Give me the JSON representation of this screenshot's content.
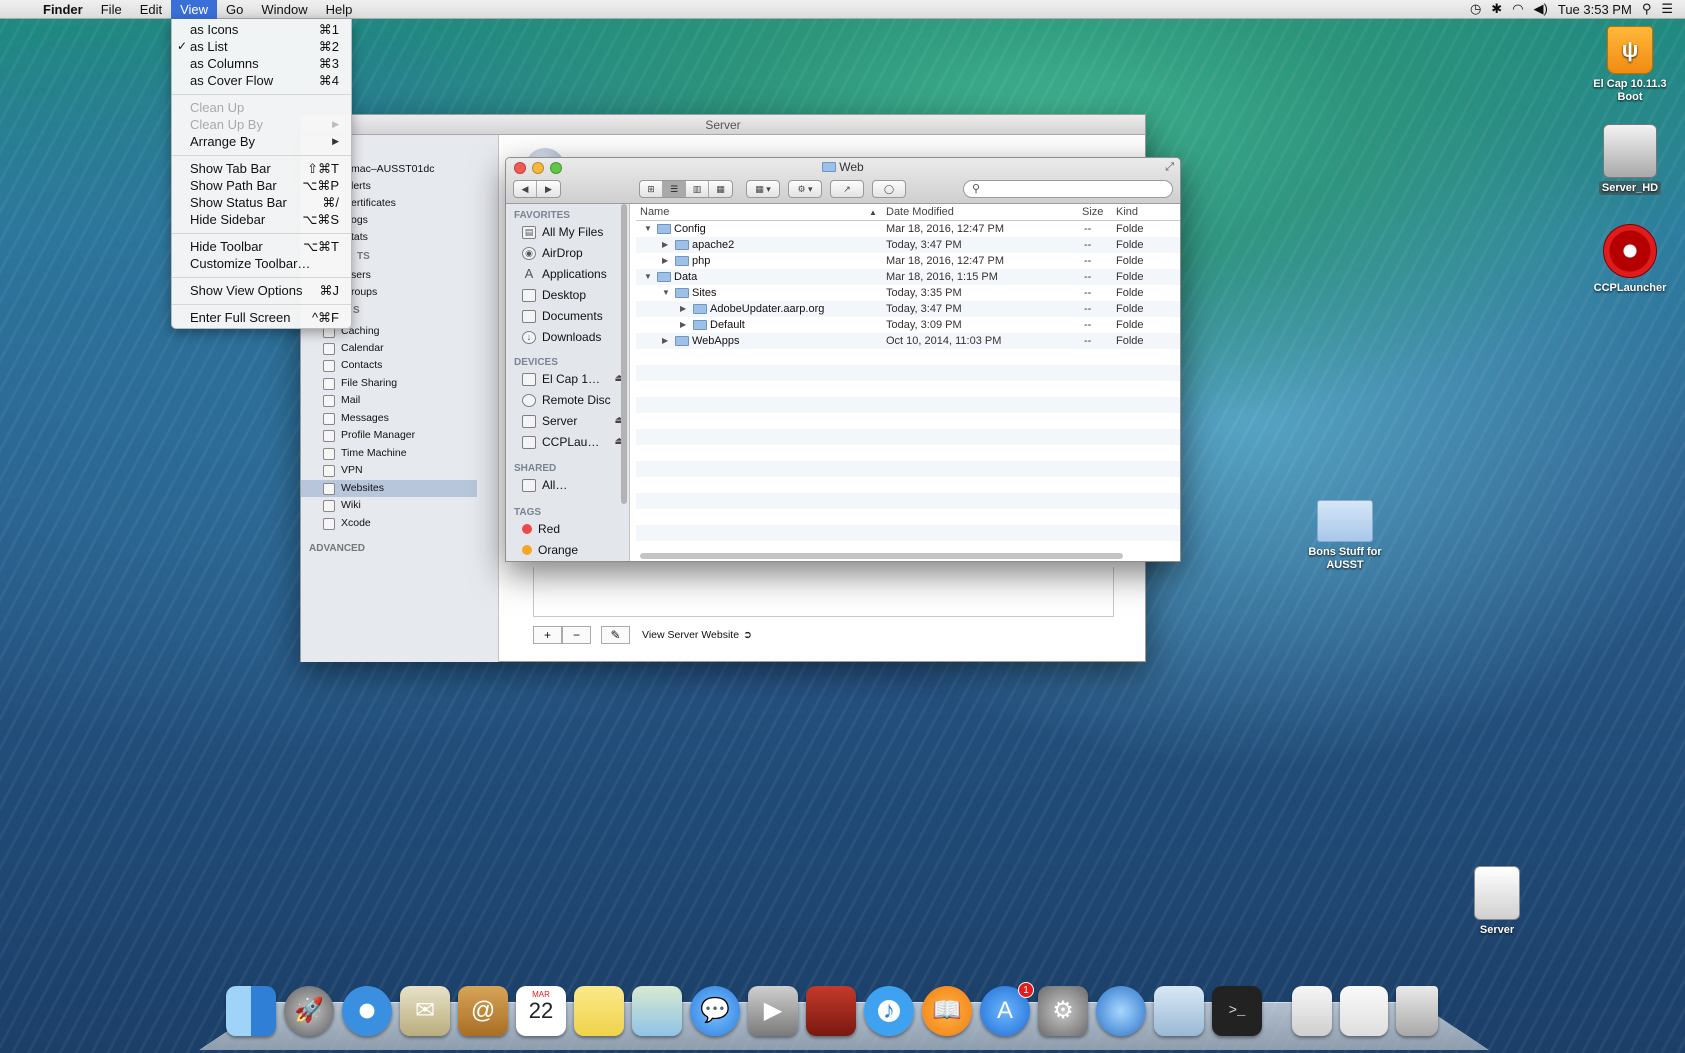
{
  "menubar": {
    "app": "Finder",
    "items": [
      "File",
      "Edit",
      "View",
      "Go",
      "Window",
      "Help"
    ],
    "clock": "Tue 3:53 PM"
  },
  "view_menu": {
    "items": [
      {
        "label": "as Icons",
        "shortcut": "⌘1",
        "checked": false,
        "disabled": false
      },
      {
        "label": "as List",
        "shortcut": "⌘2",
        "checked": true,
        "disabled": false
      },
      {
        "label": "as Columns",
        "shortcut": "⌘3",
        "checked": false,
        "disabled": false
      },
      {
        "label": "as Cover Flow",
        "shortcut": "⌘4",
        "checked": false,
        "disabled": false
      },
      {
        "label": "Clean Up",
        "shortcut": "",
        "disabled": true
      },
      {
        "label": "Clean Up By",
        "shortcut": "",
        "disabled": true,
        "submenu": true
      },
      {
        "label": "Arrange By",
        "shortcut": "",
        "disabled": false,
        "submenu": true
      },
      {
        "label": "Show Tab Bar",
        "shortcut": "⇧⌘T"
      },
      {
        "label": "Show Path Bar",
        "shortcut": "⌥⌘P"
      },
      {
        "label": "Show Status Bar",
        "shortcut": "⌘/"
      },
      {
        "label": "Hide Sidebar",
        "shortcut": "⌥⌘S"
      },
      {
        "label": "Hide Toolbar",
        "shortcut": "⌥⌘T"
      },
      {
        "label": "Customize Toolbar…",
        "shortcut": ""
      },
      {
        "label": "Show View Options",
        "shortcut": "⌘J"
      },
      {
        "label": "Enter Full Screen",
        "shortcut": "^⌘F"
      }
    ]
  },
  "server_window": {
    "title": "Server",
    "host": "mac–AUSST01dc",
    "partial_items": [
      "lerts",
      "ertificates",
      "ogs",
      "tats"
    ],
    "partial_section": "TS",
    "partial_items2": [
      "sers",
      "roups"
    ],
    "services_header": "S",
    "services": [
      "Caching",
      "Calendar",
      "Contacts",
      "File Sharing",
      "Mail",
      "Messages",
      "Profile Manager",
      "Time Machine",
      "VPN",
      "Websites",
      "Wiki",
      "Xcode"
    ],
    "selected_service": "Websites",
    "advanced_header": "ADVANCED",
    "add_label": "+",
    "remove_label": "−",
    "edit_label": "✎",
    "view_site_label": "View Server Website"
  },
  "finder": {
    "title": "Web",
    "search_placeholder": "",
    "sidebar": {
      "favorites_header": "FAVORITES",
      "favorites": [
        "All My Files",
        "AirDrop",
        "Applications",
        "Desktop",
        "Documents",
        "Downloads"
      ],
      "devices_header": "DEVICES",
      "devices": [
        "El Cap 1…",
        "Remote Disc",
        "Server",
        "CCPLau…"
      ],
      "shared_header": "SHARED",
      "shared": [
        "All…"
      ],
      "tags_header": "TAGS",
      "tags": [
        "Red",
        "Orange"
      ]
    },
    "columns": {
      "name": "Name",
      "date": "Date Modified",
      "size": "Size",
      "kind": "Kind"
    },
    "rows": [
      {
        "name": "Config",
        "date": "Mar 18, 2016, 12:47 PM",
        "size": "--",
        "kind": "Folde",
        "level": 0,
        "open": true
      },
      {
        "name": "apache2",
        "date": "Today, 3:47 PM",
        "size": "--",
        "kind": "Folde",
        "level": 1,
        "open": false
      },
      {
        "name": "php",
        "date": "Mar 18, 2016, 12:47 PM",
        "size": "--",
        "kind": "Folde",
        "level": 1,
        "open": false
      },
      {
        "name": "Data",
        "date": "Mar 18, 2016, 1:15 PM",
        "size": "--",
        "kind": "Folde",
        "level": 0,
        "open": true
      },
      {
        "name": "Sites",
        "date": "Today, 3:35 PM",
        "size": "--",
        "kind": "Folde",
        "level": 1,
        "open": true
      },
      {
        "name": "AdobeUpdater.aarp.org",
        "date": "Today, 3:47 PM",
        "size": "--",
        "kind": "Folde",
        "level": 2,
        "open": false
      },
      {
        "name": "Default",
        "date": "Today, 3:09 PM",
        "size": "--",
        "kind": "Folde",
        "level": 2,
        "open": false
      },
      {
        "name": "WebApps",
        "date": "Oct 10, 2014, 11:03 PM",
        "size": "--",
        "kind": "Folde",
        "level": 1,
        "open": false
      }
    ]
  },
  "desktop": {
    "icons": [
      {
        "label": "El Cap 10.11.3 Boot",
        "kind": "usb-drive-icon"
      },
      {
        "label": "Server_HD",
        "kind": "hard-drive-icon"
      },
      {
        "label": "CCPLauncher",
        "kind": "disc-icon"
      },
      {
        "label": "Bons Stuff for AUSST",
        "kind": "folder-icon"
      },
      {
        "label": "Server",
        "kind": "external-drive-icon"
      }
    ]
  },
  "dock": {
    "items": [
      "finder-icon",
      "launchpad-icon",
      "safari-icon",
      "mail-icon",
      "contacts-icon",
      "calendar-icon",
      "notes-icon",
      "maps-icon",
      "messages-icon",
      "facetime-icon",
      "photo-booth-icon",
      "itunes-icon",
      "ibooks-icon",
      "app-store-icon",
      "system-preferences-icon",
      "network-utility-icon",
      "preview-icon",
      "terminal-icon",
      "documents-stack-icon",
      "downloads-stack-icon",
      "trash-icon"
    ],
    "calendar_month": "MAR",
    "calendar_day": "22",
    "app_store_badge": "1"
  }
}
